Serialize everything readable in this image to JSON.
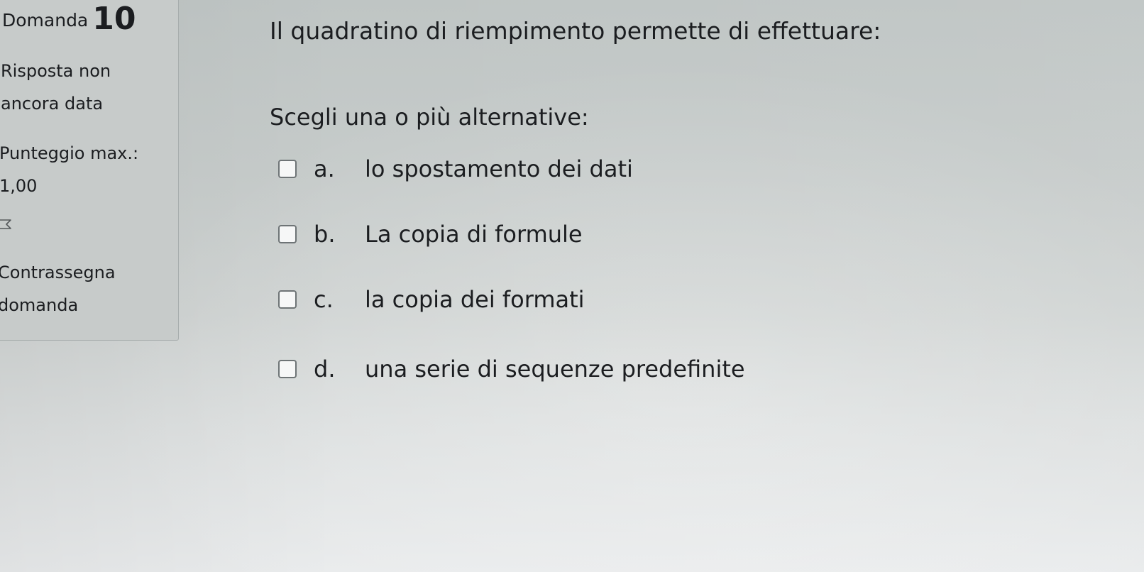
{
  "info": {
    "question_label": "Domanda",
    "question_number": "10",
    "state_line1": "Risposta non",
    "state_line2": "ancora data",
    "grade_line1": "Punteggio max.:",
    "grade_line2": "1,00",
    "flag_line1": "Contrassegna",
    "flag_line2": "domanda"
  },
  "question": {
    "text": "Il quadratino di riempimento permette di effettuare:",
    "prompt": "Scegli una o più alternative:",
    "options": [
      {
        "letter": "a.",
        "text": "lo spostamento dei dati",
        "checked": false
      },
      {
        "letter": "b.",
        "text": "La copia di formule",
        "checked": false
      },
      {
        "letter": "c.",
        "text": "la copia dei formati",
        "checked": false
      },
      {
        "letter": "d.",
        "text": "una serie di sequenze predefinite",
        "checked": false
      }
    ]
  },
  "icons": {
    "flag": "flag-outline-icon"
  },
  "colors": {
    "background": "#c6cbca",
    "text": "#1b1d20",
    "checkbox_border": "#6e7476"
  }
}
